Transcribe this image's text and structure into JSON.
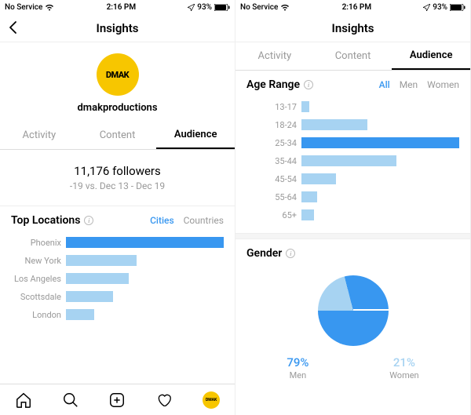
{
  "status": {
    "carrier": "No Service",
    "time": "2:16 PM",
    "battery": "93%"
  },
  "header": {
    "title": "Insights"
  },
  "profile": {
    "username": "dmakproductions",
    "avatar_text": "DMAK"
  },
  "tabs": {
    "activity": "Activity",
    "content": "Content",
    "audience": "Audience"
  },
  "followers": {
    "count": "11,176 followers",
    "delta": "-19 vs. Dec 13 - Dec 19"
  },
  "locations": {
    "title": "Top Locations",
    "filter_cities": "Cities",
    "filter_countries": "Countries"
  },
  "age": {
    "title": "Age Range",
    "filter_all": "All",
    "filter_men": "Men",
    "filter_women": "Women"
  },
  "gender": {
    "title": "Gender",
    "men_pct": "79%",
    "men_label": "Men",
    "women_pct": "21%",
    "women_label": "Women"
  },
  "chart_data": [
    {
      "type": "bar",
      "name": "top_locations",
      "title": "Top Locations",
      "orientation": "horizontal",
      "categories": [
        "Phoenix",
        "New York",
        "Los Angeles",
        "Scottsdale",
        "London"
      ],
      "values": [
        100,
        45,
        40,
        30,
        18
      ],
      "highlight_index": 0,
      "unit": "relative_percent"
    },
    {
      "type": "bar",
      "name": "age_range",
      "title": "Age Range",
      "orientation": "horizontal",
      "categories": [
        "13-17",
        "18-24",
        "25-34",
        "35-44",
        "45-54",
        "55-64",
        "65+"
      ],
      "values": [
        5,
        42,
        100,
        60,
        22,
        10,
        8
      ],
      "highlight_index": 2,
      "unit": "relative_percent"
    },
    {
      "type": "pie",
      "name": "gender",
      "title": "Gender",
      "series": [
        {
          "name": "Men",
          "value": 79,
          "color": "#3897f0"
        },
        {
          "name": "Women",
          "value": 21,
          "color": "#a7d3f2"
        }
      ]
    }
  ]
}
